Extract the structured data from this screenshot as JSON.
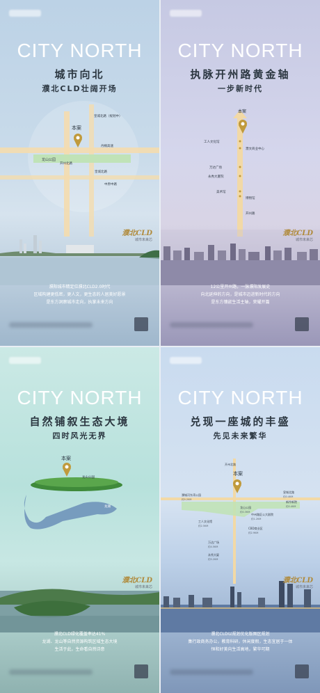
{
  "brand": "CITY NORTH",
  "panels": [
    {
      "title": "城市向北",
      "subtitle": "濮北CLD壮阔开场",
      "here": "本案",
      "logo": "濮北CLD",
      "logo_sub": "城市未来芯",
      "roads": [
        "皇城北路（规划中）",
        "开州北路",
        "龙山公园",
        "丹桐高速",
        "皇城北路",
        "中原中路"
      ],
      "desc": [
        "濮阳城市精定位濮北CLD2.0时代",
        "区域构建更低密，更人文，更生态的人居美好愿景",
        "是东方洞察城市走向，执掌未来方向"
      ]
    },
    {
      "title": "执脉开州路黄金轴",
      "subtitle": "一步新时代",
      "here": "本案",
      "logo": "濮北CLD",
      "logo_sub": "城市未来芯",
      "stops": [
        "工人文化馆",
        "濮文商业中心",
        "万达广场",
        "永秀大厦院",
        "美术馆",
        "博物馆",
        "开州路"
      ],
      "desc": [
        "12公里开州路，一脉濮阳发展史",
        "向北延伸的方向，是城市迈进新时代的方向",
        "是东方镶嵌生活主轴，荣耀开篇"
      ]
    },
    {
      "title": "自然铺叙生态大境",
      "subtitle": "四时风光无界",
      "here": "本案",
      "logo": "濮北CLD",
      "logo_sub": "城市未来芯",
      "labels": [
        "龙山公园",
        "龙湖"
      ],
      "desc": [
        "濮北CLD绿化覆盖率达41%",
        "龙湖、龙山等自然资源构筑区域生态大境",
        "生活于此，生命看自然诗意"
      ]
    },
    {
      "title": "兑现一座城的丰盛",
      "subtitle": "先见未来繁华",
      "here": "本案",
      "logo": "濮北CLD",
      "logo_sub": "城市未来芯",
      "labels": [
        "开州北路",
        "濮城河东湾公园",
        "约0.2KM",
        "龙山公园",
        "约0.3KM",
        "皇城北路",
        "约0.4KM",
        "新作新院",
        "约0.4KM",
        "中州路区公大剧院",
        "约1.2KM",
        "工人文化馆",
        "约2.5KM",
        "CBD商业区",
        "约2.9KM",
        "万达广场",
        "约4.5KM",
        "永秀大厦",
        "约5.2KM"
      ],
      "desc": [
        "濮北CLD以规划优化版图区规划",
        "集行政商务办公，教育科研，休闲度假，生态宜居于一体",
        "恒和好美向生活高地，繁华可期"
      ]
    }
  ],
  "colors": {
    "gold": "#c09a3c",
    "road": "#f2d9a6",
    "green": "#bfe3b4"
  }
}
